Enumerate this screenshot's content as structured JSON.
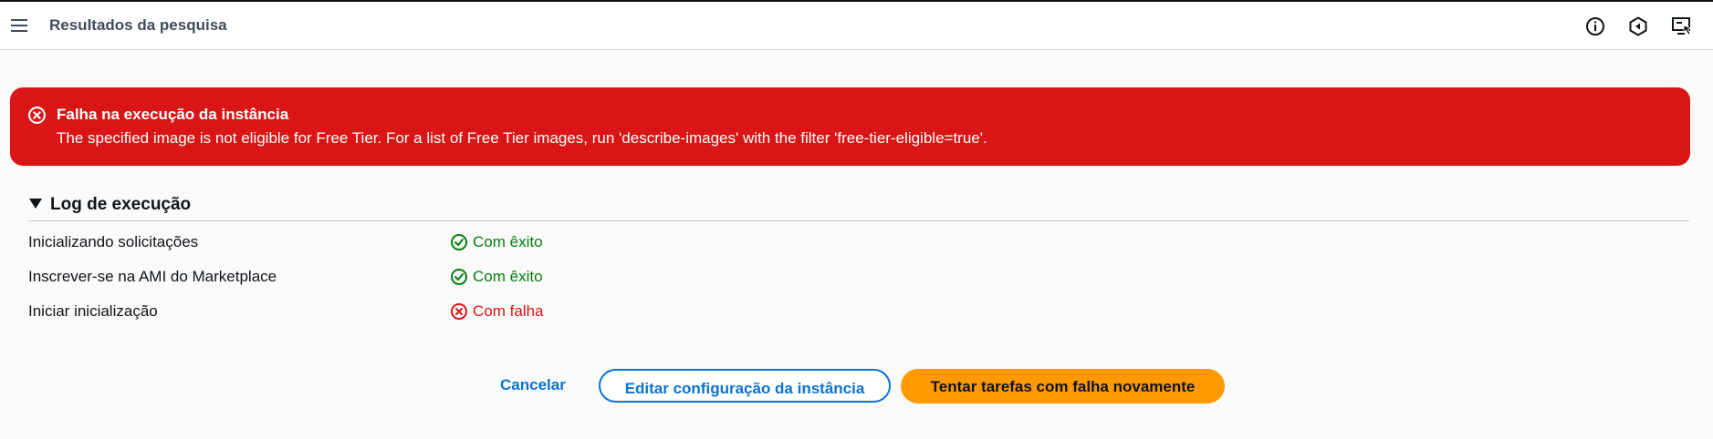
{
  "header": {
    "title": "Resultados da pesquisa",
    "icons": [
      "menu-icon",
      "info-icon",
      "feedback-icon",
      "screen-monitor-icon"
    ]
  },
  "alert": {
    "type": "error",
    "title": "Falha na execução da instância",
    "message": "The specified image is not eligible for Free Tier. For a list of Free Tier images, run 'describe-images' with the filter 'free-tier-eligible=true'.",
    "color": "#d91515"
  },
  "log": {
    "title": "Log de execução",
    "expanded": true,
    "items": [
      {
        "label": "Inicializando solicitações",
        "status": "Com êxito",
        "state": "success"
      },
      {
        "label": "Inscrever-se na AMI do Marketplace",
        "status": "Com êxito",
        "state": "success"
      },
      {
        "label": "Iniciar inicialização",
        "status": "Com falha",
        "state": "error"
      }
    ]
  },
  "actions": {
    "cancel": "Cancelar",
    "edit": "Editar configuração da instância",
    "retry": "Tentar tarefas com falha novamente"
  },
  "colors": {
    "primary_button": "#ff9900",
    "link": "#0972d3",
    "success": "#037f0c",
    "error": "#d91515"
  }
}
